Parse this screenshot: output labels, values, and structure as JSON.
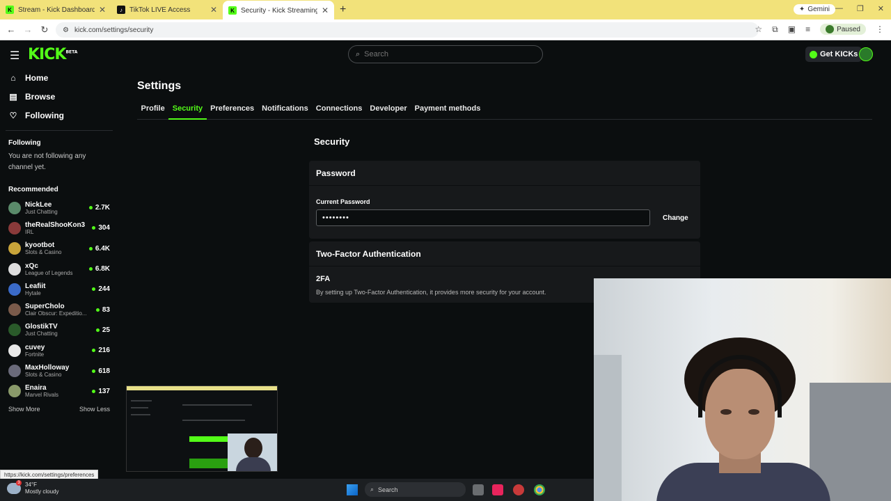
{
  "browser": {
    "tabs": [
      {
        "title": "Stream - Kick Dashboard",
        "icon": "kick-favicon-icon",
        "color": "#53fc18"
      },
      {
        "title": "TikTok LIVE Access",
        "icon": "tiktok-favicon-icon",
        "color": "#111111"
      },
      {
        "title": "Security - Kick Streaming",
        "icon": "kick-favicon-icon",
        "color": "#53fc18"
      }
    ],
    "gemini_label": "Gemini",
    "url": "kick.com/settings/security",
    "profile_status": "Paused"
  },
  "header": {
    "logo_text": "KICK",
    "logo_badge": "BETA",
    "search_placeholder": "Search",
    "get_kicks_label": "Get KICKs"
  },
  "sidebar": {
    "nav": [
      {
        "label": "Home",
        "icon": "home-icon"
      },
      {
        "label": "Browse",
        "icon": "browse-icon"
      },
      {
        "label": "Following",
        "icon": "heart-icon"
      }
    ],
    "following_title": "Following",
    "following_empty": "You are not following any channel yet.",
    "recommended_title": "Recommended",
    "channels": [
      {
        "name": "NickLee",
        "category": "Just Chatting",
        "viewers": "2.7K",
        "color": "#5a8a6a"
      },
      {
        "name": "theRealShooKon3",
        "category": "IRL",
        "viewers": "304",
        "color": "#8a3a3a"
      },
      {
        "name": "kyootbot",
        "category": "Slots & Casino",
        "viewers": "6.4K",
        "color": "#c8a43a"
      },
      {
        "name": "xQc",
        "category": "League of Legends",
        "viewers": "6.8K",
        "color": "#dddddd"
      },
      {
        "name": "Leafiit",
        "category": "Hytale",
        "viewers": "244",
        "color": "#3a6ac8"
      },
      {
        "name": "SuperCholo",
        "category": "Clair Obscur: Expeditio...",
        "viewers": "83",
        "color": "#7a5a4a"
      },
      {
        "name": "GlostikTV",
        "category": "Just Chatting",
        "viewers": "25",
        "color": "#2a5a2a"
      },
      {
        "name": "cuvey",
        "category": "Fortnite",
        "viewers": "216",
        "color": "#e8e8e8"
      },
      {
        "name": "MaxHolloway",
        "category": "Slots & Casino",
        "viewers": "618",
        "color": "#6a6a7a"
      },
      {
        "name": "Enaira",
        "category": "Marvel Rivals",
        "viewers": "137",
        "color": "#8a9a6a"
      }
    ],
    "show_more": "Show More",
    "show_less": "Show Less"
  },
  "settings": {
    "title": "Settings",
    "tabs": [
      {
        "label": "Profile",
        "active": false
      },
      {
        "label": "Security",
        "active": true
      },
      {
        "label": "Preferences",
        "active": false
      },
      {
        "label": "Notifications",
        "active": false
      },
      {
        "label": "Connections",
        "active": false
      },
      {
        "label": "Developer",
        "active": false
      },
      {
        "label": "Payment methods",
        "active": false
      }
    ],
    "section_title": "Security",
    "password": {
      "card_title": "Password",
      "field_label": "Current Password",
      "value": "••••••••",
      "change_label": "Change"
    },
    "tfa": {
      "card_title": "Two-Factor Authentication",
      "label": "2FA",
      "description": "By setting up Two-Factor Authentication, it provides more security for your account."
    }
  },
  "status_url": "https://kick.com/settings/preferences",
  "taskbar": {
    "temp": "34°F",
    "weather": "Mostly cloudy",
    "weather_badge": "3",
    "search": "Search"
  },
  "colors": {
    "accent": "#53fc18",
    "background": "#0b0e0f",
    "card": "#17191b"
  }
}
